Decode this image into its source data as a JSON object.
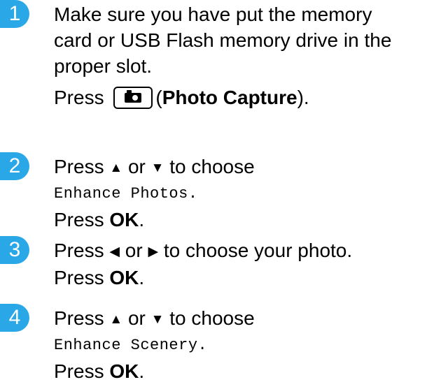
{
  "steps": [
    {
      "number": "1",
      "lines": [
        "Make sure you have put the memory",
        "card or USB Flash memory drive in the",
        "proper slot."
      ],
      "press_prefix": "Press",
      "button_icon": "camera-icon",
      "button_label": "Photo Capture",
      "open_paren": "(",
      "close_paren": ")."
    },
    {
      "number": "2",
      "press": "Press",
      "arrow_a": "▲",
      "or": "or",
      "arrow_b": "▼",
      "suffix": "to choose",
      "menu_value": "Enhance Photos.",
      "press_ok_prefix": "Press",
      "ok": "OK",
      "period": "."
    },
    {
      "number": "3",
      "press": "Press",
      "arrow_a": "◀",
      "or": "or",
      "arrow_b": "▶",
      "suffix": "to choose your photo.",
      "press_ok_prefix": "Press",
      "ok": "OK",
      "period": "."
    },
    {
      "number": "4",
      "press": "Press",
      "arrow_a": "▲",
      "or": "or",
      "arrow_b": "▼",
      "suffix": "to choose",
      "menu_value": "Enhance Scenery.",
      "press_ok_prefix": "Press",
      "ok": "OK",
      "period": "."
    }
  ],
  "colors": {
    "badge": "#2aa7e6"
  }
}
